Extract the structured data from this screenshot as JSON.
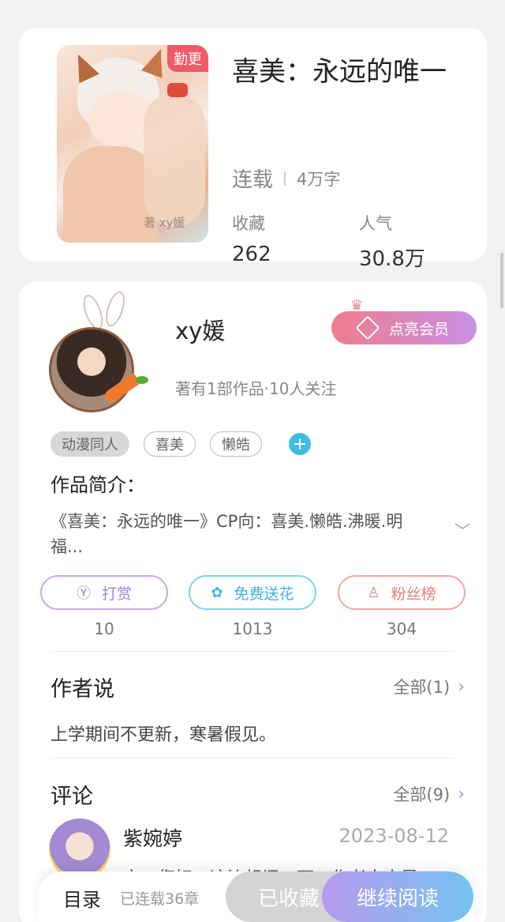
{
  "book": {
    "update_badge": "勤更",
    "cover_signature": "著 xy媛",
    "title": "喜美：永远的唯一",
    "status": "连载",
    "word_count": "4万字",
    "favorites_label": "收藏",
    "favorites_value": "262",
    "popularity_label": "人气",
    "popularity_value": "30.8万"
  },
  "author": {
    "name": "xy媛",
    "subtitle": "著有1部作品·10人关注",
    "vip_label": "点亮会员",
    "tags": [
      "动漫同人",
      "喜美",
      "懒皓"
    ],
    "add_tag": "+",
    "intro_heading": "作品简介：",
    "intro_text": "《喜美：永远的唯一》CP向：喜美.懒皓.沸暖.明福...",
    "actions": [
      {
        "label": "打赏",
        "icon": "yen-coin-icon",
        "count": "10"
      },
      {
        "label": "免费送花",
        "icon": "flower-icon",
        "count": "1013"
      },
      {
        "label": "粉丝榜",
        "icon": "fans-icon",
        "count": "304"
      }
    ]
  },
  "author_say": {
    "title": "作者说",
    "more": "全部(1)",
    "text": "上学期间不更新，寒暑假见。"
  },
  "comments": {
    "title": "评论",
    "more": "全部(9)",
    "items": [
      {
        "name": "紫婉婷",
        "date": "2023-08-12",
        "text": "亲，您好，这边想问一下，作者大大是"
      }
    ]
  },
  "bottom_bar": {
    "toc": "目录",
    "chapters": "已连载36章",
    "favorited": "已收藏",
    "continue": "继续阅读"
  },
  "colors": {
    "accent_purple": "#a38ed9",
    "badge_red": "#ef5a64",
    "flower_blue": "#3fb4dc",
    "fans_red": "#e27f76"
  }
}
